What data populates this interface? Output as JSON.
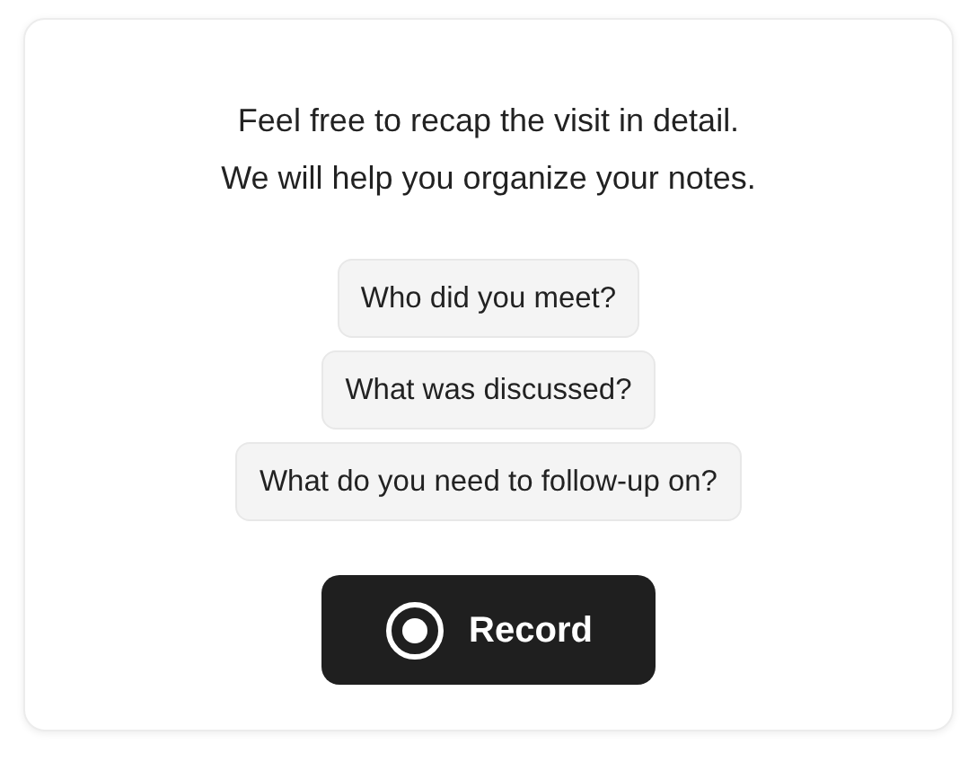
{
  "intro": [
    "Feel free to recap the visit in detail.",
    "We will help you organize your notes."
  ],
  "prompts": [
    "Who did you meet?",
    "What was discussed?",
    "What do you need to follow-up on?"
  ],
  "record_button": {
    "label": "Record"
  }
}
